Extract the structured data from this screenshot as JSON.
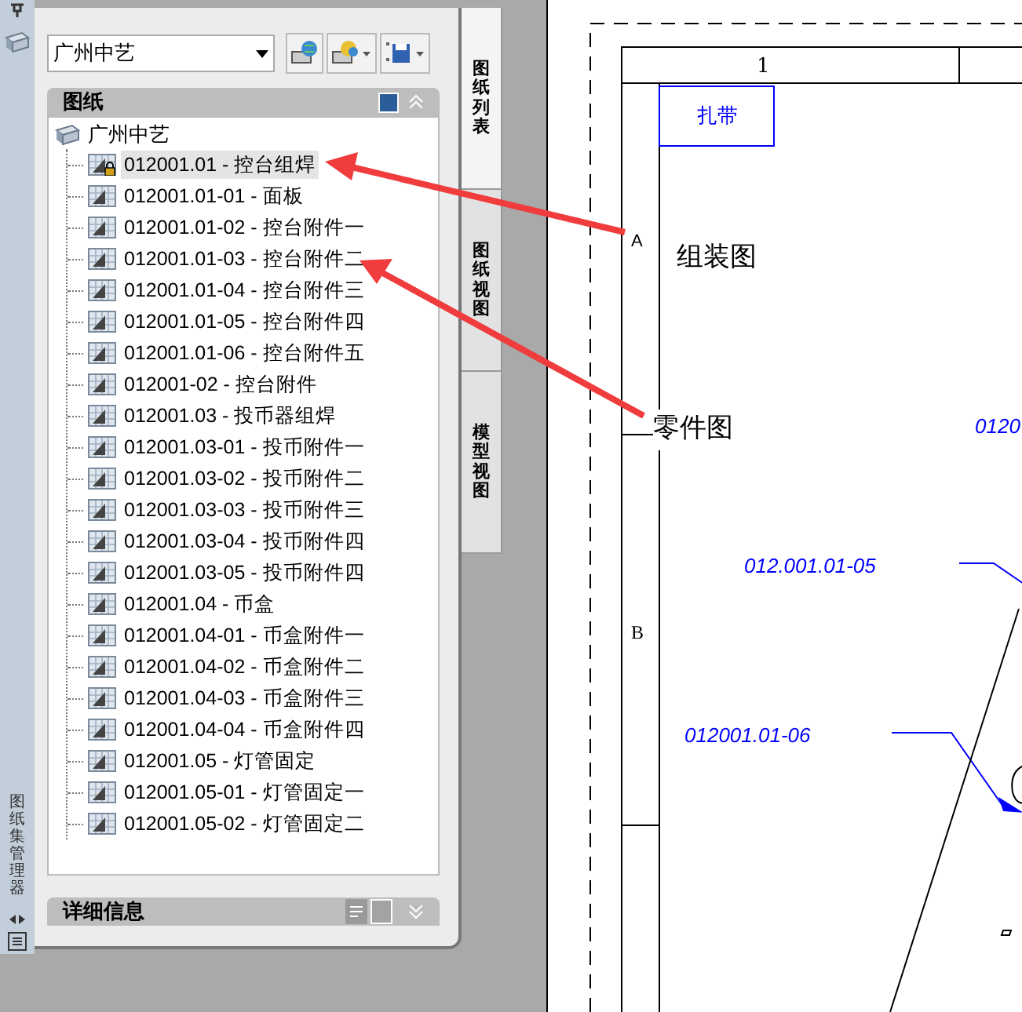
{
  "side_strip": {
    "title": "图纸集管理器"
  },
  "sheet_set_dropdown": {
    "value": "广州中艺"
  },
  "sheets_panel": {
    "title": "图纸",
    "tree": {
      "label": "广州中艺",
      "children": [
        {
          "label": "012001.01 - 控台组焊",
          "selected": true,
          "locked": true
        },
        {
          "label": "012001.01-01 - 面板",
          "selected": false,
          "locked": false
        },
        {
          "label": "012001.01-02 - 控台附件一",
          "selected": false,
          "locked": false
        },
        {
          "label": "012001.01-03 - 控台附件二",
          "selected": false,
          "locked": false
        },
        {
          "label": "012001.01-04 - 控台附件三",
          "selected": false,
          "locked": false
        },
        {
          "label": "012001.01-05 - 控台附件四",
          "selected": false,
          "locked": false
        },
        {
          "label": "012001.01-06 - 控台附件五",
          "selected": false,
          "locked": false
        },
        {
          "label": "012001-02 - 控台附件",
          "selected": false,
          "locked": false
        },
        {
          "label": "012001.03 - 投币器组焊",
          "selected": false,
          "locked": false
        },
        {
          "label": "012001.03-01 - 投币附件一",
          "selected": false,
          "locked": false
        },
        {
          "label": "012001.03-02 - 投币附件二",
          "selected": false,
          "locked": false
        },
        {
          "label": "012001.03-03 - 投币附件三",
          "selected": false,
          "locked": false
        },
        {
          "label": "012001.03-04 - 投币附件四",
          "selected": false,
          "locked": false
        },
        {
          "label": "012001.03-05 - 投币附件四",
          "selected": false,
          "locked": false
        },
        {
          "label": "012001.04 - 币盒",
          "selected": false,
          "locked": false
        },
        {
          "label": "012001.04-01 - 币盒附件一",
          "selected": false,
          "locked": false
        },
        {
          "label": "012001.04-02 - 币盒附件二",
          "selected": false,
          "locked": false
        },
        {
          "label": "012001.04-03 - 币盒附件三",
          "selected": false,
          "locked": false
        },
        {
          "label": "012001.04-04 - 币盒附件四",
          "selected": false,
          "locked": false
        },
        {
          "label": "012001.05 - 灯管固定",
          "selected": false,
          "locked": false
        },
        {
          "label": "012001.05-01 - 灯管固定一",
          "selected": false,
          "locked": false
        },
        {
          "label": "012001.05-02 - 灯管固定二",
          "selected": false,
          "locked": false
        }
      ]
    }
  },
  "details_panel": {
    "title": "详细信息"
  },
  "tabs": [
    {
      "label": "图纸列表",
      "selected": true
    },
    {
      "label": "图纸视图",
      "selected": false
    },
    {
      "label": "模型视图",
      "selected": false
    }
  ],
  "drawing": {
    "column_label": "1",
    "row_labels": [
      "A",
      "B"
    ],
    "title_box": "扎带",
    "leaders": [
      "012.001.01-05",
      "012001.01-06"
    ],
    "cut_label": "0120"
  },
  "annotations": [
    "组装图",
    "零件图"
  ]
}
